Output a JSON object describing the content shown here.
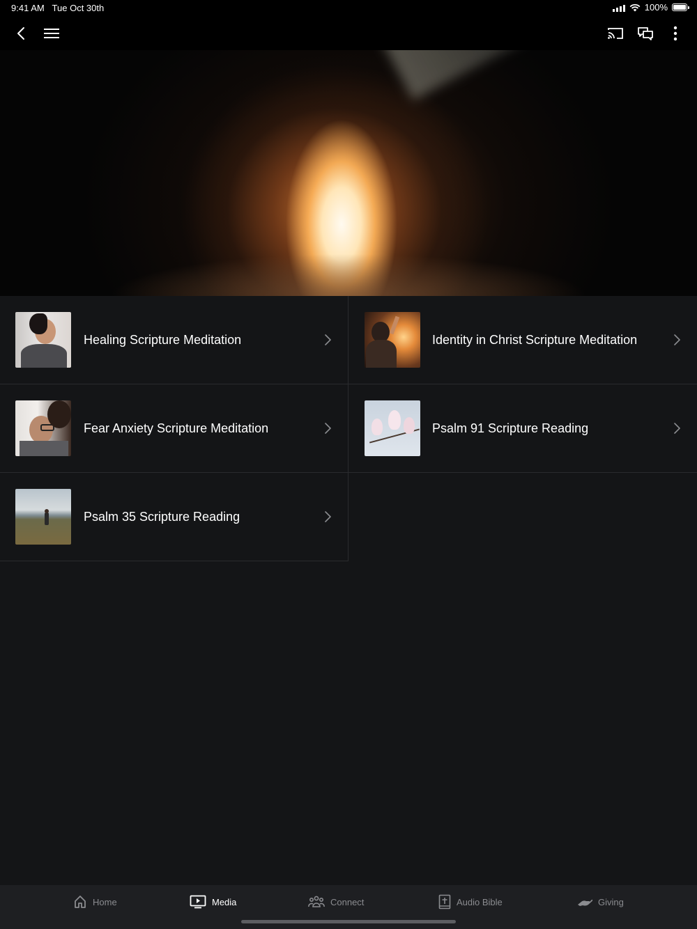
{
  "status_bar": {
    "time": "9:41 AM",
    "date": "Tue Oct 30th",
    "battery": "100%"
  },
  "nav": {
    "back_icon": "chevron-left-icon",
    "menu_icon": "hamburger-menu-icon",
    "cast_icon": "cast-icon",
    "chat_icon": "chat-bubbles-icon",
    "more_icon": "more-vertical-icon"
  },
  "hero": {
    "image": "cave-light-opening"
  },
  "items": [
    {
      "title": "Healing Scripture Meditation",
      "thumb": "woman-profile-photo"
    },
    {
      "title": "Identity in Christ Scripture Meditation",
      "thumb": "woman-sunset-photo"
    },
    {
      "title": "Fear Anxiety Scripture Meditation",
      "thumb": "couple-embrace-photo"
    },
    {
      "title": "Psalm 91 Scripture Reading",
      "thumb": "magnolia-blossoms-photo"
    },
    {
      "title": "Psalm 35 Scripture Reading",
      "thumb": "person-field-photo"
    }
  ],
  "tabs": [
    {
      "label": "Home",
      "icon": "home-icon"
    },
    {
      "label": "Media",
      "icon": "media-tv-icon",
      "active": true
    },
    {
      "label": "Connect",
      "icon": "people-group-icon"
    },
    {
      "label": "Audio Bible",
      "icon": "bible-icon"
    },
    {
      "label": "Giving",
      "icon": "giving-hand-icon"
    }
  ],
  "colors": {
    "background": "#141517",
    "tabbar": "#1e1f22",
    "tab_inactive": "#8b8c90",
    "tab_active": "#ffffff"
  }
}
